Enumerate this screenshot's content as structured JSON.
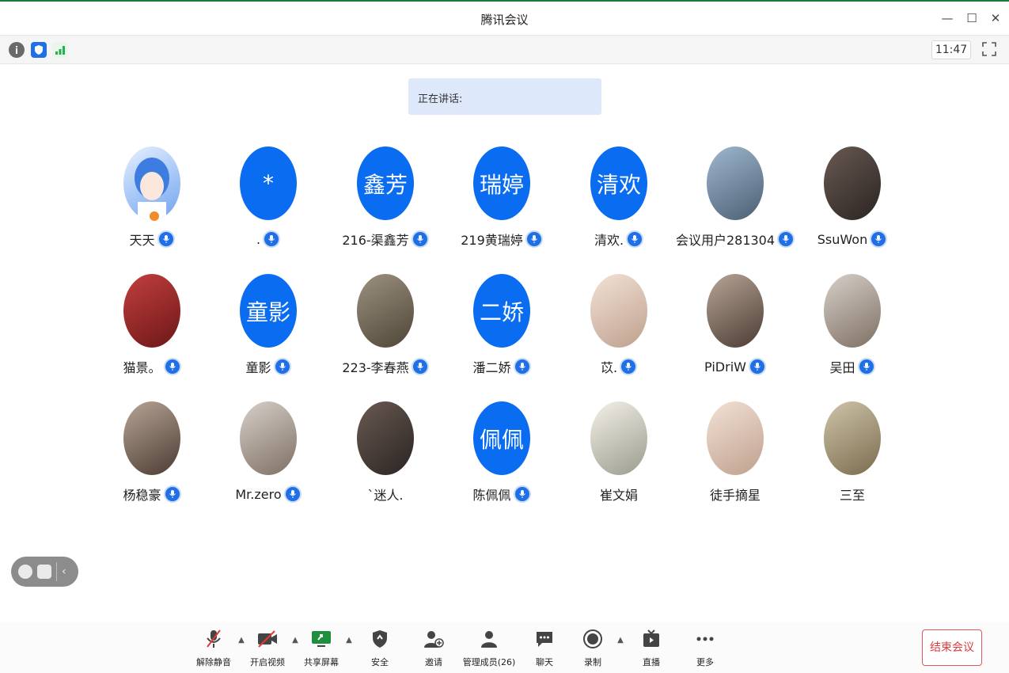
{
  "window": {
    "title": "腾讯会议",
    "minimize_icon": "minimize-icon",
    "maximize_icon": "maximize-icon",
    "close_icon": "close-icon"
  },
  "infobar": {
    "time": "11:47",
    "icons": [
      "info-icon",
      "shield-icon",
      "signal-icon",
      "fullscreen-icon"
    ]
  },
  "speaking": {
    "label": "正在讲话:"
  },
  "participants": [
    {
      "name": "天天",
      "avatar_type": "photo",
      "host": true
    },
    {
      "name": ".",
      "avatar_type": "text",
      "avatar_text": "*"
    },
    {
      "name": "216-渠鑫芳",
      "avatar_type": "text",
      "avatar_text": "鑫芳"
    },
    {
      "name": "219黄瑞婷",
      "avatar_type": "text",
      "avatar_text": "瑞婷"
    },
    {
      "name": "清欢.",
      "avatar_type": "text",
      "avatar_text": "清欢"
    },
    {
      "name": "会议用户281304",
      "avatar_type": "photo"
    },
    {
      "name": "SsuWon",
      "avatar_type": "photo"
    },
    {
      "name": "猫景。",
      "avatar_type": "photo"
    },
    {
      "name": "童影",
      "avatar_type": "text",
      "avatar_text": "童影"
    },
    {
      "name": "223-李春燕",
      "avatar_type": "photo"
    },
    {
      "name": "潘二娇",
      "avatar_type": "text",
      "avatar_text": "二娇"
    },
    {
      "name": "苡.",
      "avatar_type": "photo"
    },
    {
      "name": "PiDriW",
      "avatar_type": "photo"
    },
    {
      "name": "吴田",
      "avatar_type": "photo"
    },
    {
      "name": "杨稳豪",
      "avatar_type": "photo"
    },
    {
      "name": "Mr.zero",
      "avatar_type": "photo"
    },
    {
      "name": "`迷人.",
      "avatar_type": "photo",
      "mic": false
    },
    {
      "name": "陈佩佩",
      "avatar_type": "text",
      "avatar_text": "佩佩"
    },
    {
      "name": "崔文娟",
      "avatar_type": "photo",
      "mic": false
    },
    {
      "name": "徒手摘星",
      "avatar_type": "photo",
      "mic": false
    },
    {
      "name": "三至",
      "avatar_type": "photo",
      "mic": false
    }
  ],
  "toolbar": {
    "unmute": "解除静音",
    "start_video": "开启视频",
    "share_screen": "共享屏幕",
    "security": "安全",
    "invite": "邀请",
    "manage_members": "管理成员(26)",
    "chat": "聊天",
    "record": "录制",
    "live": "直播",
    "more": "更多",
    "end_meeting": "结束会议"
  },
  "colors": {
    "accent_blue": "#0a6cf0",
    "end_red": "#e03a3a",
    "speaking_bg": "#dde9fb"
  }
}
